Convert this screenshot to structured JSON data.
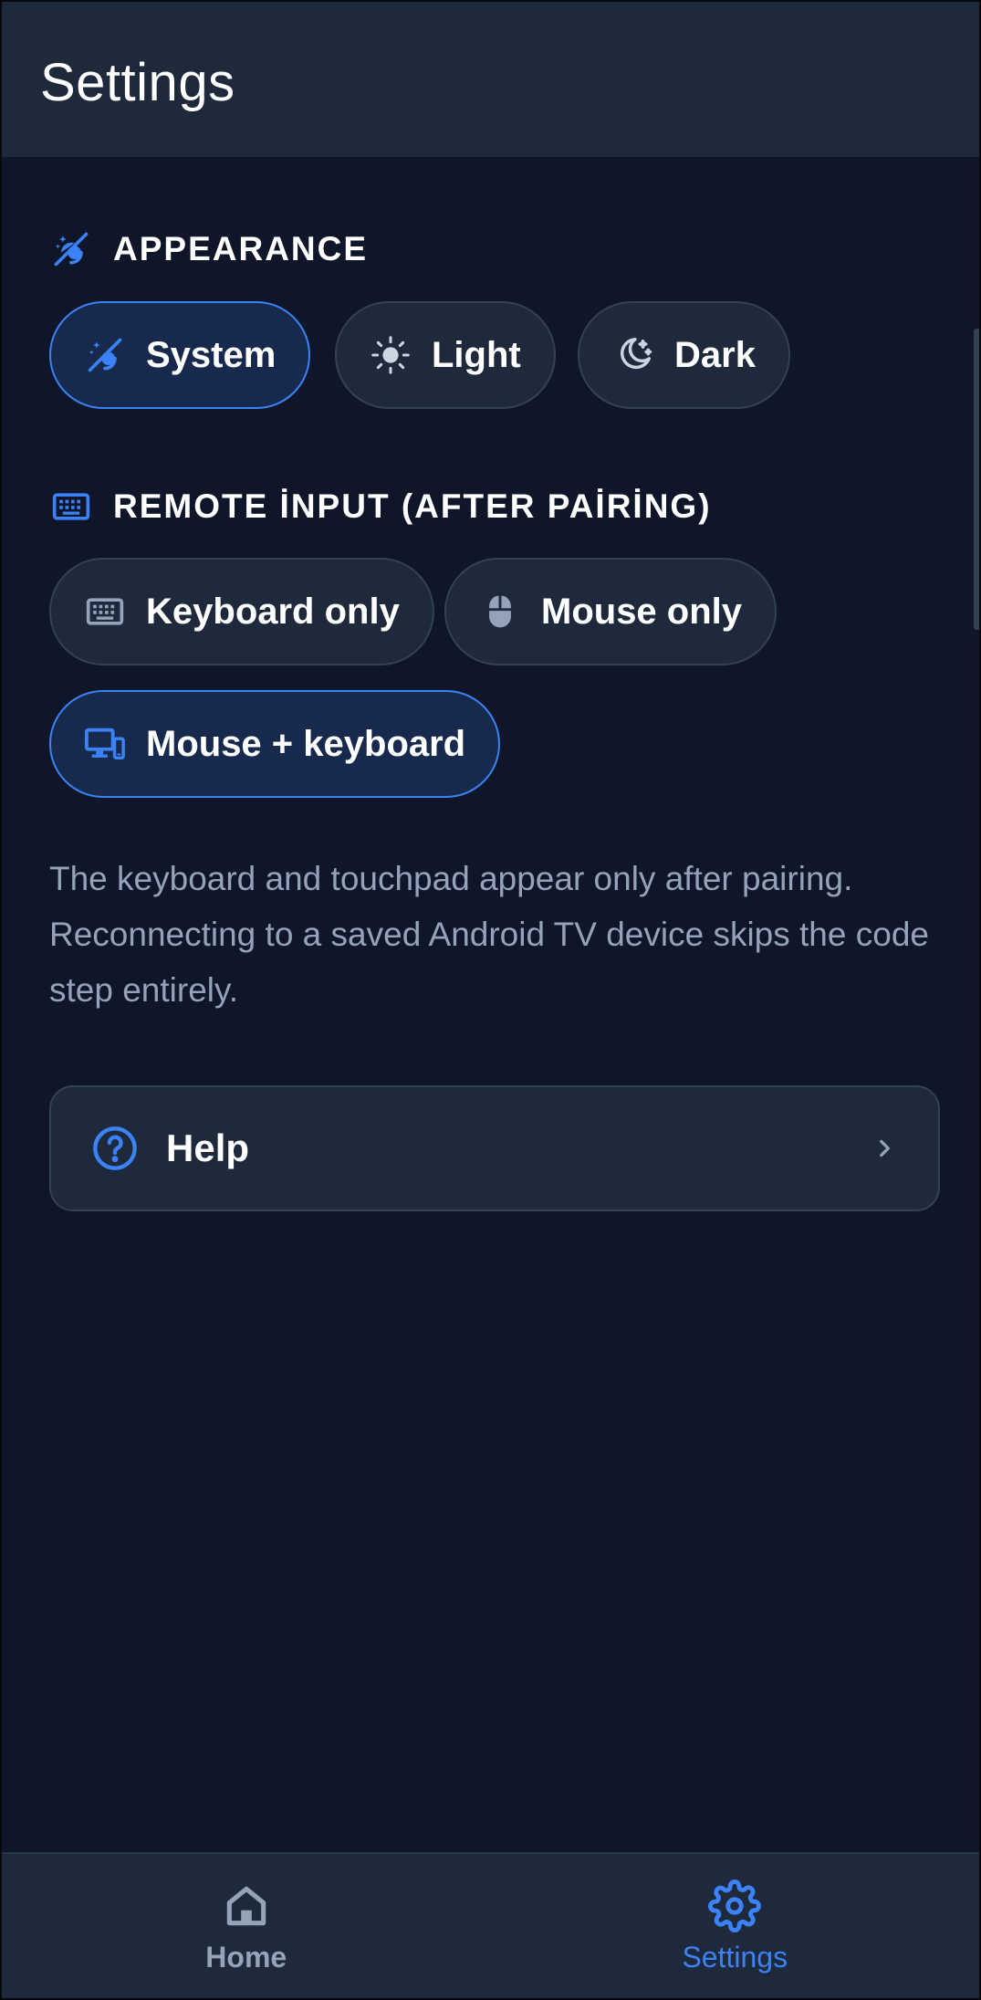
{
  "appbar": {
    "title": "Settings"
  },
  "appearance": {
    "header": "APPEARANCE",
    "header_icon": "theme-auto-icon",
    "options": [
      {
        "label": "System",
        "icon": "theme-auto-icon",
        "selected": true
      },
      {
        "label": "Light",
        "icon": "sun-icon",
        "selected": false
      },
      {
        "label": "Dark",
        "icon": "moon-icon",
        "selected": false
      }
    ]
  },
  "remote_input": {
    "header": "REMOTE İNPUT (AFTER PAİRİNG)",
    "header_icon": "keyboard-icon",
    "options": [
      {
        "label": "Keyboard only",
        "icon": "keyboard-icon",
        "selected": false
      },
      {
        "label": "Mouse only",
        "icon": "mouse-icon",
        "selected": false
      },
      {
        "label": "Mouse + keyboard",
        "icon": "devices-icon",
        "selected": true
      }
    ],
    "helper_text": "The keyboard and touchpad appear only after pairing. Reconnecting to a saved Android TV device skips the code step entirely."
  },
  "help": {
    "label": "Help",
    "icon": "help-circle-icon"
  },
  "bottom_nav": {
    "items": [
      {
        "label": "Home",
        "icon": "home-icon",
        "active": false
      },
      {
        "label": "Settings",
        "icon": "gear-icon",
        "active": true
      }
    ]
  },
  "colors": {
    "background": "#0f1629",
    "surface": "#1e293b",
    "accent": "#3b82f6",
    "muted_text": "#94a3b8"
  }
}
